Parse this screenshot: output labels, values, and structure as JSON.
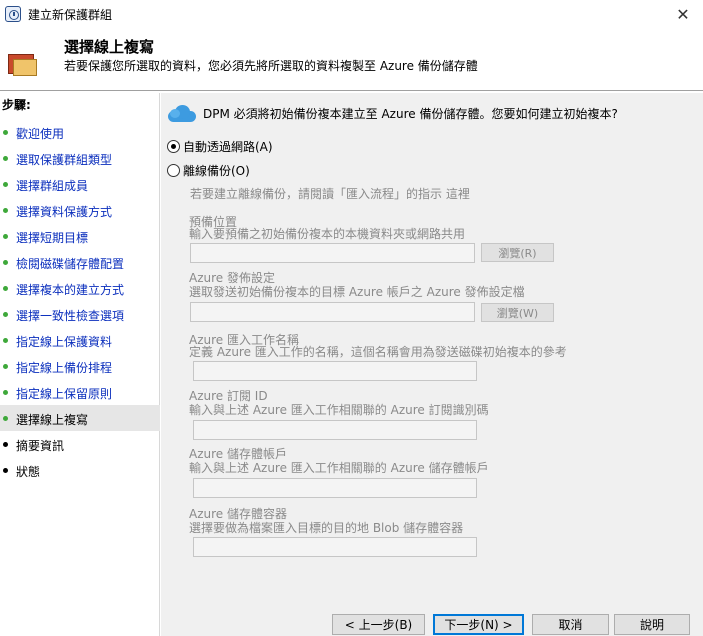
{
  "window": {
    "title": "建立新保護群組",
    "close_glyph": "✕"
  },
  "header": {
    "title": "選擇線上複寫",
    "subtitle": "若要保護您所選取的資料，您必須先將所選取的資料複製至 Azure 備份儲存體"
  },
  "sidebar": {
    "steps_label": "步驟:",
    "items": [
      {
        "label": "歡迎使用"
      },
      {
        "label": "選取保護群組類型"
      },
      {
        "label": "選擇群組成員"
      },
      {
        "label": "選擇資料保護方式"
      },
      {
        "label": "選擇短期目標"
      },
      {
        "label": "檢閱磁碟儲存體配置"
      },
      {
        "label": "選擇複本的建立方式"
      },
      {
        "label": "選擇一致性檢查選項"
      },
      {
        "label": "指定線上保護資料"
      },
      {
        "label": "指定線上備份排程"
      },
      {
        "label": "指定線上保留原則"
      },
      {
        "label": "選擇線上複寫"
      },
      {
        "label": "摘要資訊"
      },
      {
        "label": "狀態"
      }
    ]
  },
  "main": {
    "question": "DPM 必須將初始備份複本建立至 Azure 備份儲存體。您要如何建立初始複本?",
    "option_online": "自動透過網路(A)",
    "option_offline": "離線備份(O)",
    "offline_hint": "若要建立離線備份，請閱讀「匯入流程」的指示  這裡",
    "staging_title": "預備位置",
    "staging_desc": "輸入要預備之初始備份複本的本機資料夾或網路共用",
    "browse_r": "瀏覽(R)",
    "publish_title": "Azure 發佈設定",
    "publish_desc": "選取發送初始備份複本的目標 Azure 帳戶之 Azure 發佈設定檔",
    "browse_w": "瀏覽(W)",
    "job_title": "Azure 匯入工作名稱",
    "job_desc": "定義 Azure 匯入工作的名稱，這個名稱會用為發送磁碟初始複本的參考",
    "sub_title": "Azure 訂閱 ID",
    "sub_desc": "輸入與上述 Azure 匯入工作相關聯的 Azure 訂閱識別碼",
    "acct_title": "Azure 儲存體帳戶",
    "acct_desc": "輸入與上述 Azure 匯入工作相關聯的 Azure 儲存體帳戶",
    "container_title": "Azure 儲存體容器",
    "container_desc": "選擇要做為檔案匯入目標的目的地 Blob 儲存體容器"
  },
  "buttons": {
    "back": "< 上一步(B)",
    "next": "下一步(N) >",
    "cancel": "取消",
    "help": "說明"
  }
}
